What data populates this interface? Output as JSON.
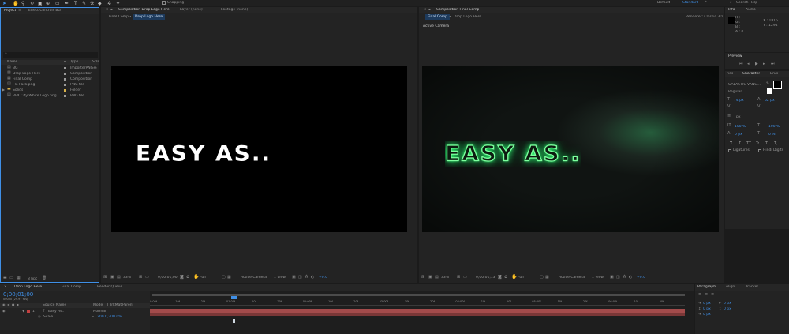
{
  "toolbar": {
    "snapping_label": "Snapping",
    "workspaces": [
      "Default",
      "Standard"
    ],
    "search_help": "Search Help"
  },
  "project_panel": {
    "tabs": [
      "Project",
      "Effect Controls BG"
    ],
    "columns": {
      "name": "Name",
      "type": "Type",
      "size": "Size"
    },
    "items": [
      {
        "name": "BG",
        "type": "ImporterPNG"
      },
      {
        "name": "Drop Logo Here",
        "type": "Composition"
      },
      {
        "name": "Final Comp",
        "type": "Composition"
      },
      {
        "name": "Flo Pack.png",
        "type": "PNG file"
      },
      {
        "name": "Solids",
        "type": "Folder"
      },
      {
        "name": "VFX City White Logo.png",
        "type": "PNG file"
      }
    ],
    "bpc": "8 bpc"
  },
  "viewer_left": {
    "tabs": [
      "Composition Drop Logo Here",
      "Layer (none)",
      "Footage (none)"
    ],
    "subtabs": [
      "Final Comp",
      "Drop Logo Here"
    ],
    "content_text": "EASY AS..",
    "footer": {
      "zoom": "33%",
      "timecode": "0;00;01;00",
      "resolution": "Full",
      "camera": "Active Camera",
      "views": "1 View",
      "exposure": "+0.0"
    }
  },
  "viewer_right": {
    "tab": "Composition Final Comp",
    "subtabs": [
      "Final Comp",
      "Drop Logo Here"
    ],
    "renderer": "Renderer: Classic 3D",
    "camera_label": "Active Camera",
    "content_text": "EASY AS..",
    "glow_color": "#2dff73",
    "footer": {
      "zoom": "33%",
      "timecode": "0;00;01;13",
      "resolution": "Full",
      "camera": "Active Camera",
      "views": "1 View",
      "exposure": "+0.0"
    }
  },
  "info_panel": {
    "tabs": [
      "Info",
      "Audio"
    ],
    "rgb": [
      "R :",
      "G :",
      "B :",
      "A : 0"
    ],
    "coords": [
      "X : 1815",
      "Y : 1294"
    ]
  },
  "preview_panel": {
    "title": "Preview"
  },
  "character_panel": {
    "tabs": [
      "ries",
      "Character",
      "Brus"
    ],
    "font": "GALACTIC VANG...",
    "style": "Regular",
    "size": "74 px",
    "leading": "62 px",
    "tracking_unit": "px",
    "vscale": "100 %",
    "hscale": "100 %",
    "baseline": "0 px",
    "tsume": "0 %",
    "ligatures": "Ligatures",
    "hindi": "Hindi Digits",
    "style_buttons": [
      "T",
      "T",
      "TT",
      "Tr",
      "T",
      "T,"
    ]
  },
  "timeline": {
    "tabs": [
      "Drop Logo Here",
      "Final Comp",
      "Render Queue"
    ],
    "timecode": "0;00;01;00",
    "fps_info": "00030 (29.97 fps)",
    "columns": {
      "source": "Source Name",
      "mode": "Mode",
      "trkmat": "T TrkMat",
      "parent": "Parent"
    },
    "layer": {
      "index": "1",
      "name": "Easy As..",
      "mode": "Normal"
    },
    "property": {
      "name": "Scale",
      "value": "200.0,200.0%"
    },
    "ruler": [
      "0:00f",
      "10f",
      "20f",
      "01:00f",
      "10f",
      "20f",
      "02:00f",
      "10f",
      "20f",
      "03:00f",
      "10f",
      "20f",
      "04:00f",
      "10f",
      "20f",
      "05:00f",
      "10f",
      "20f",
      "06:00f",
      "10f",
      "20f"
    ]
  },
  "paragraph_panel": {
    "tabs": [
      "Paragraph",
      "Align",
      "Tracker"
    ],
    "fields": [
      "0 px",
      "0 px",
      "0 px",
      "0 px",
      "0 px"
    ]
  }
}
